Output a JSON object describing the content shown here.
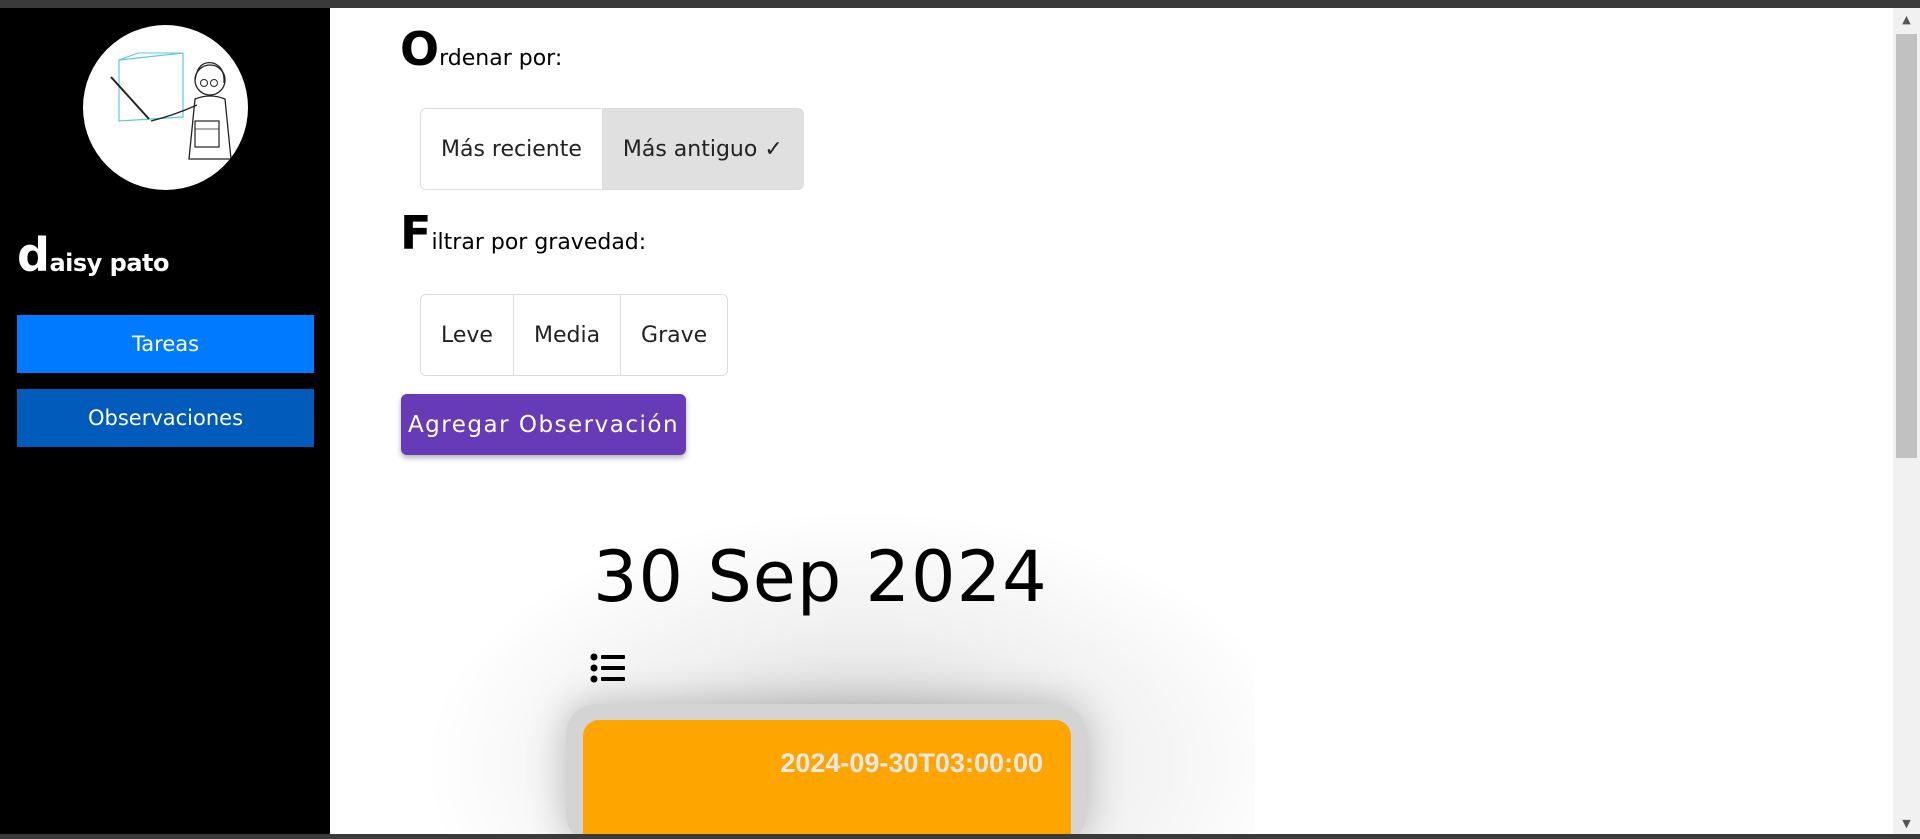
{
  "sidebar": {
    "user": {
      "initial": "d",
      "rest": "aisy pato"
    },
    "nav": [
      {
        "label": "Tareas"
      },
      {
        "label": "Observaciones"
      }
    ]
  },
  "main": {
    "order": {
      "heading_initial": "O",
      "heading_rest": "rdenar por:",
      "options": [
        {
          "label": "Más reciente",
          "active": false
        },
        {
          "label": "Más antiguo ✓",
          "active": true
        }
      ]
    },
    "filter": {
      "heading_initial": "F",
      "heading_rest": "iltrar por gravedad:",
      "options": [
        {
          "label": "Leve"
        },
        {
          "label": "Media"
        },
        {
          "label": "Grave"
        }
      ]
    },
    "add_button": "Agregar Observación",
    "group": {
      "date_title": "30 Sep 2024",
      "card": {
        "datetime": "2024-09-30T03:00:00",
        "color": "#ffa500"
      }
    }
  },
  "colors": {
    "sidebar_bg": "#000000",
    "tareas_button": "#007bff",
    "observaciones_button": "#005bbb",
    "add_button": "#673ab7",
    "card_color": "#ffa500"
  }
}
